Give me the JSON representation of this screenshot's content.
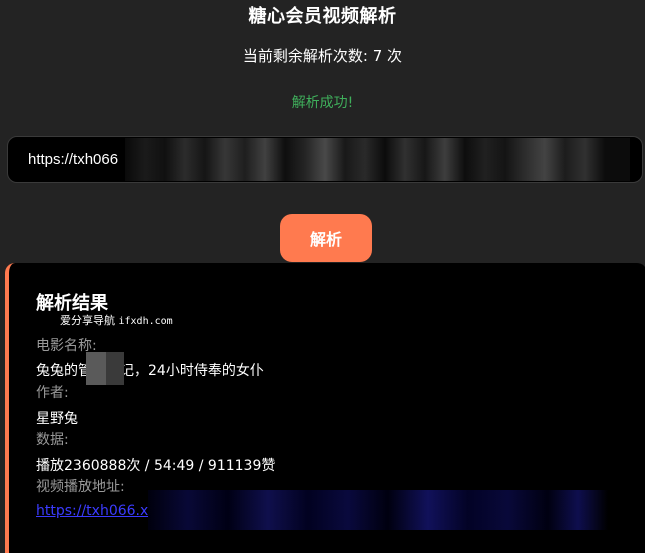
{
  "header": {
    "title": "糖心会员视频解析",
    "remaining_text": "当前剩余解析次数: 7 次",
    "status_text": "解析成功!"
  },
  "url_input": {
    "value": "https://txh066"
  },
  "parse_button": {
    "label": "解析"
  },
  "result": {
    "title": "解析结果",
    "watermark_text": "爱分享导航",
    "watermark_domain": "ifxdh.com",
    "fields": [
      {
        "label": "电影名称:",
        "value": "兔兔的管理日记，24小时侍奉的女仆"
      },
      {
        "label": "作者:",
        "value": "星野兔"
      },
      {
        "label": "数据:",
        "value": "播放2360888次 / 54:49 / 911139赞"
      },
      {
        "label": "视频播放地址:",
        "value": "https://txh066.x"
      }
    ]
  },
  "colors": {
    "accent": "#ff7a4f",
    "success": "#3fae5b",
    "background": "#232323",
    "card": "#000000",
    "link": "#3b3bff"
  }
}
